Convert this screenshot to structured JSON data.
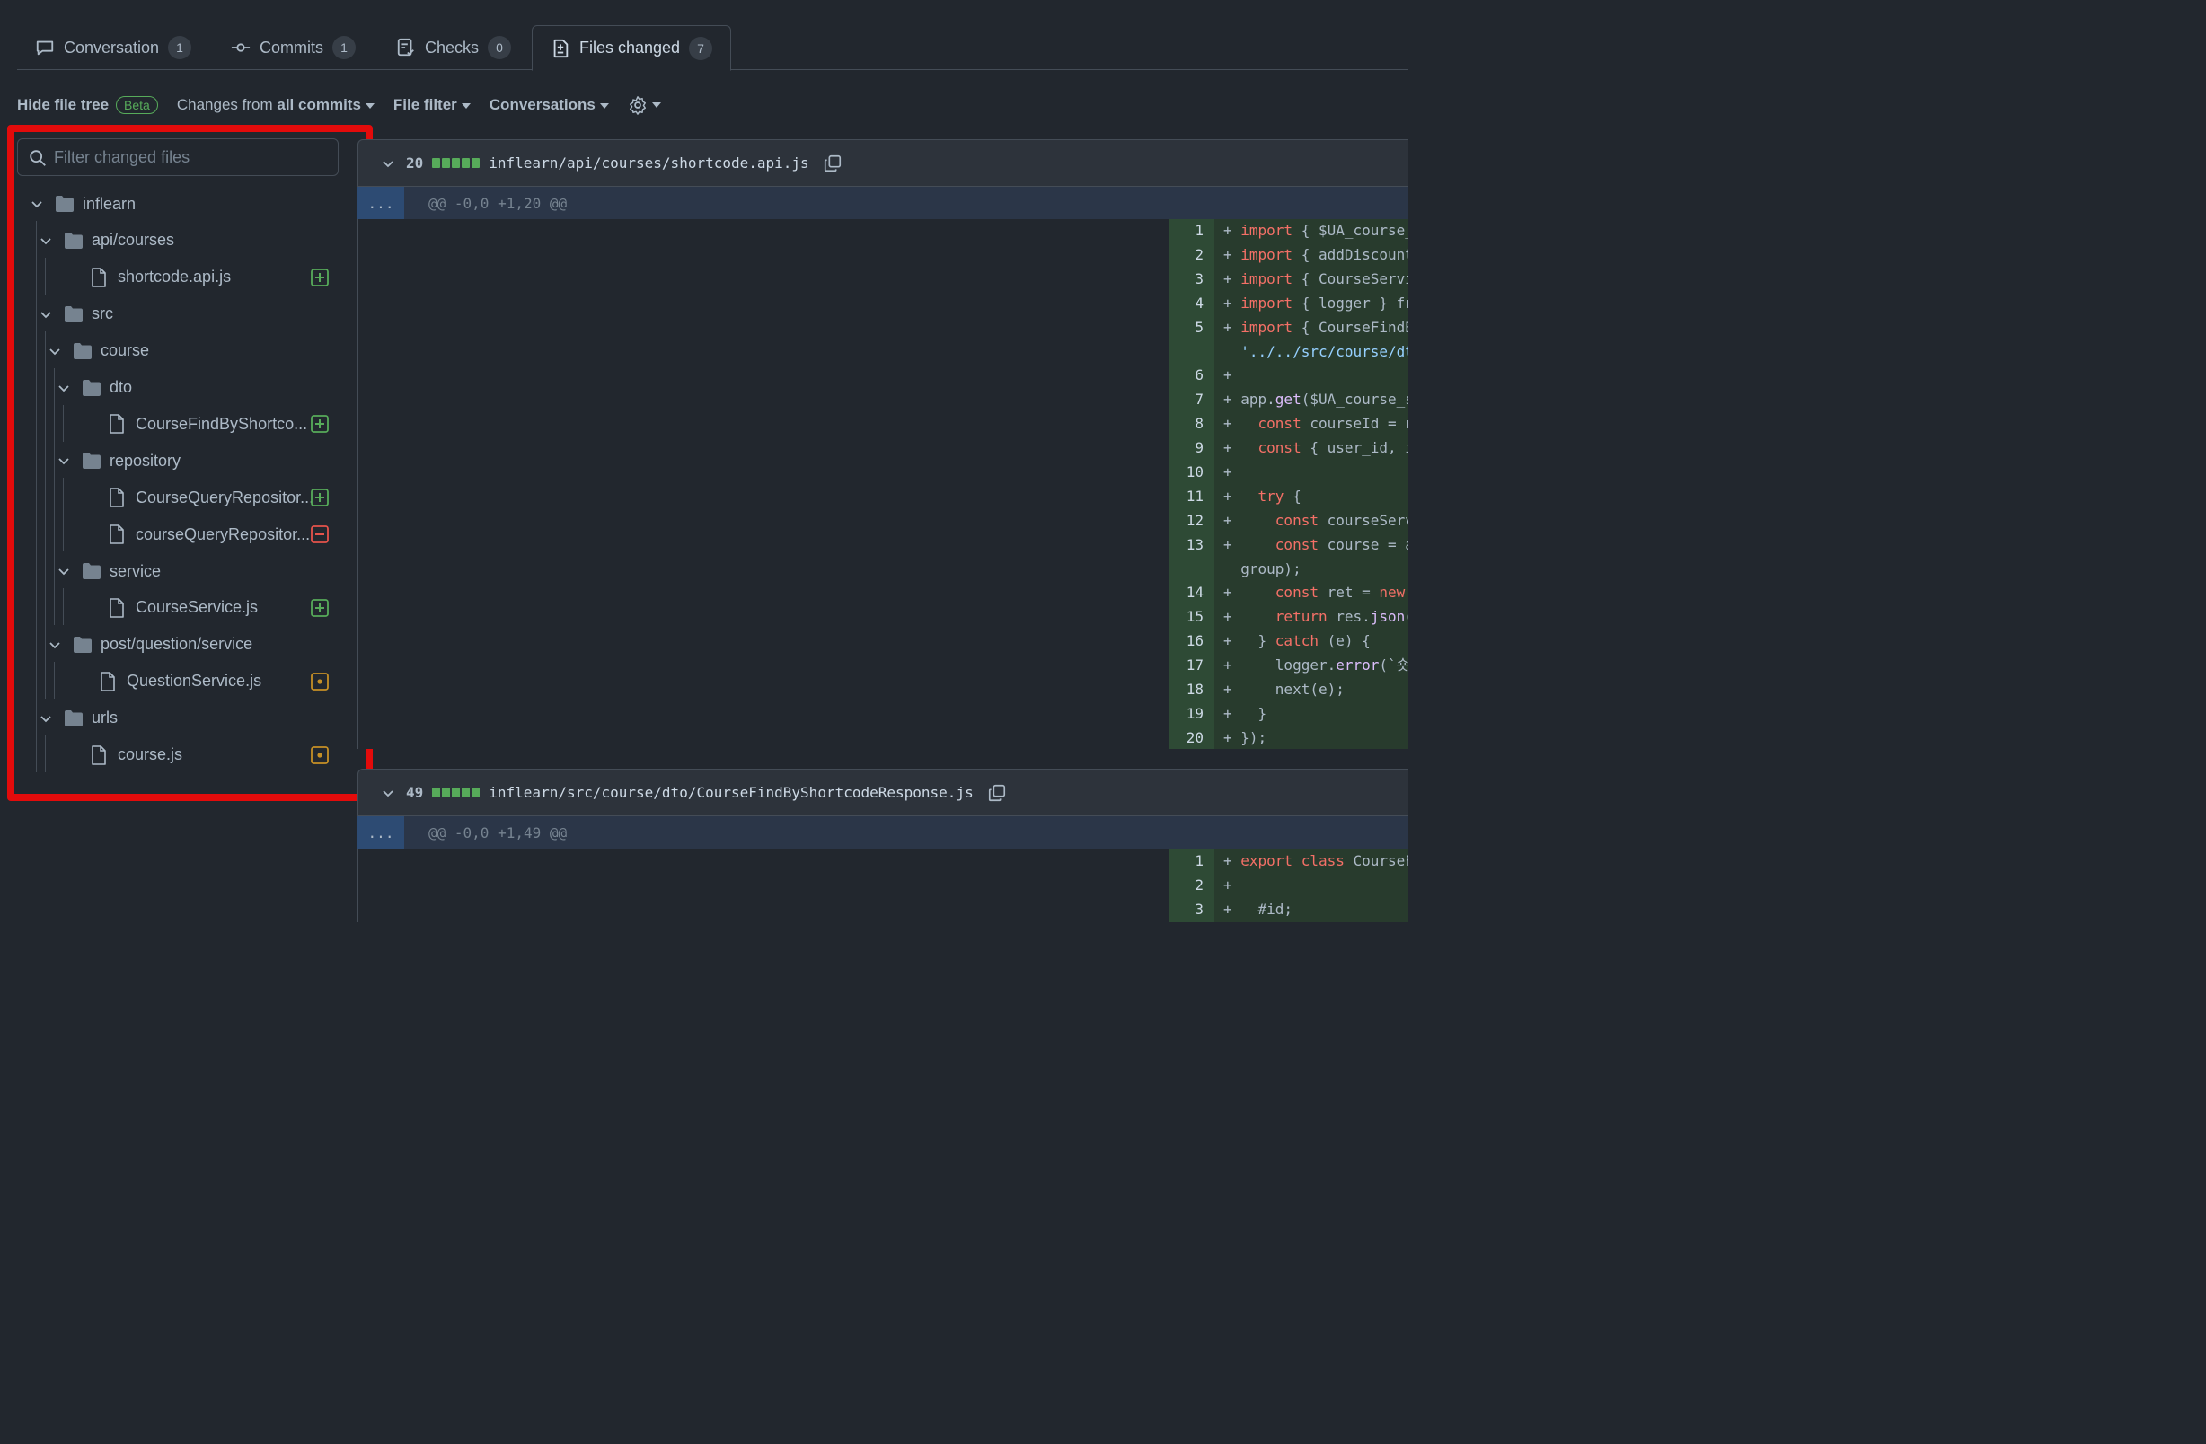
{
  "tabs": [
    {
      "label": "Conversation",
      "count": "1"
    },
    {
      "label": "Commits",
      "count": "1"
    },
    {
      "label": "Checks",
      "count": "0"
    },
    {
      "label": "Files changed",
      "count": "7"
    }
  ],
  "toolbar": {
    "hide_tree": "Hide file tree",
    "beta": "Beta",
    "changes_prefix": "Changes from",
    "changes_value": "all commits",
    "file_filter": "File filter",
    "conversations": "Conversations"
  },
  "filter": {
    "placeholder": "Filter changed files"
  },
  "tree": [
    {
      "label": "inflearn",
      "kind": "folder"
    },
    {
      "label": "api/courses",
      "kind": "folder"
    },
    {
      "label": "shortcode.api.js",
      "kind": "file",
      "status": "added"
    },
    {
      "label": "src",
      "kind": "folder"
    },
    {
      "label": "course",
      "kind": "folder"
    },
    {
      "label": "dto",
      "kind": "folder"
    },
    {
      "label": "CourseFindByShortco...",
      "kind": "file",
      "status": "added"
    },
    {
      "label": "repository",
      "kind": "folder"
    },
    {
      "label": "CourseQueryRepositor...",
      "kind": "file",
      "status": "added"
    },
    {
      "label": "courseQueryRepositor...",
      "kind": "file",
      "status": "removed"
    },
    {
      "label": "service",
      "kind": "folder"
    },
    {
      "label": "CourseService.js",
      "kind": "file",
      "status": "added"
    },
    {
      "label": "post/question/service",
      "kind": "folder"
    },
    {
      "label": "QuestionService.js",
      "kind": "file",
      "status": "modified"
    },
    {
      "label": "urls",
      "kind": "folder"
    },
    {
      "label": "course.js",
      "kind": "file",
      "status": "modified"
    }
  ],
  "files": [
    {
      "count": "20",
      "path": "inflearn/api/courses/shortcode.api.js",
      "hunk": "@@ -0,0 +1,20 @@",
      "expand": "...",
      "lines": [
        {
          "n": "1",
          "t": "+ import { $UA_course_s"
        },
        {
          "n": "2",
          "t": "+ import { addDiscount"
        },
        {
          "n": "3",
          "t": "+ import { CourseServic"
        },
        {
          "n": "4",
          "t": "+ import { logger } fro"
        },
        {
          "n": "5",
          "t": "+ import { CourseFindBy"
        },
        {
          "n": "",
          "t": "  '../../src/course/dt"
        },
        {
          "n": "6",
          "t": "+"
        },
        {
          "n": "7",
          "t": "+ app.get($UA_course_sh"
        },
        {
          "n": "8",
          "t": "+   const courseId = re"
        },
        {
          "n": "9",
          "t": "+   const { user_id, in"
        },
        {
          "n": "10",
          "t": "+"
        },
        {
          "n": "11",
          "t": "+   try {"
        },
        {
          "n": "12",
          "t": "+     const courseServ"
        },
        {
          "n": "13",
          "t": "+     const course = aw"
        },
        {
          "n": "",
          "t": "  group);"
        },
        {
          "n": "14",
          "t": "+     const ret = new C"
        },
        {
          "n": "15",
          "t": "+     return res.json("
        },
        {
          "n": "16",
          "t": "+   } catch (e) {"
        },
        {
          "n": "17",
          "t": "+     logger.error(`숏코"
        },
        {
          "n": "18",
          "t": "+     next(e);"
        },
        {
          "n": "19",
          "t": "+   }"
        },
        {
          "n": "20",
          "t": "+ });"
        }
      ]
    },
    {
      "count": "49",
      "path": "inflearn/src/course/dto/CourseFindByShortcodeResponse.js",
      "hunk": "@@ -0,0 +1,49 @@",
      "expand": "...",
      "lines": [
        {
          "n": "1",
          "t": "+ export class CourseFi"
        },
        {
          "n": "2",
          "t": "+"
        },
        {
          "n": "3",
          "t": "+   #id;"
        }
      ]
    }
  ],
  "colors": {
    "added": "#57ab5a",
    "removed": "#e5534b",
    "modified": "#c69026",
    "highlight": "#e30b0b"
  }
}
